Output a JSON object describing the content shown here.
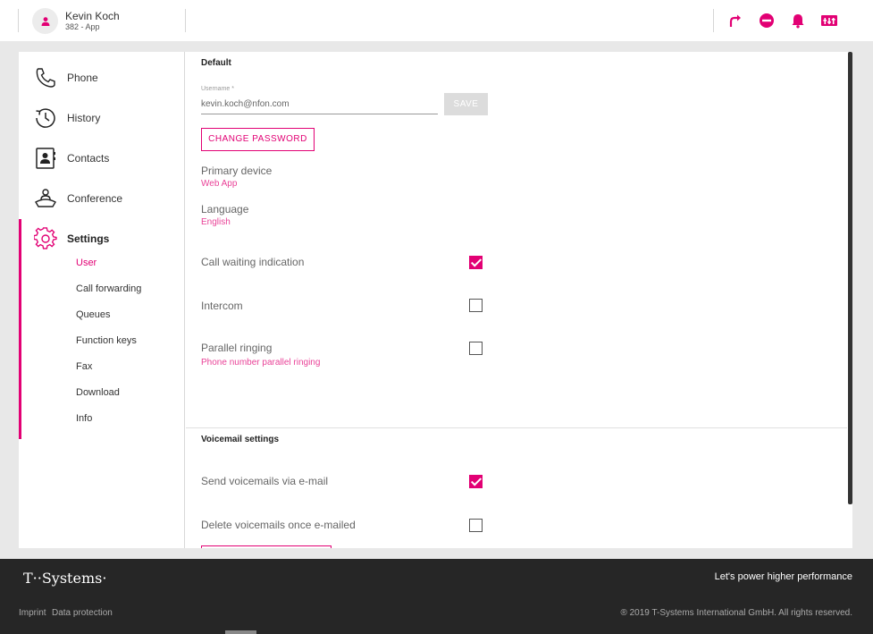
{
  "header": {
    "user_name": "Kevin Koch",
    "user_sub": "382 - App",
    "icons": [
      "redirect-icon",
      "do-not-disturb-icon",
      "bell-icon",
      "switchboard-icon"
    ]
  },
  "sidebar": {
    "items": [
      {
        "label": "Phone",
        "icon": "phone-icon"
      },
      {
        "label": "History",
        "icon": "history-icon"
      },
      {
        "label": "Contacts",
        "icon": "contacts-icon"
      },
      {
        "label": "Conference",
        "icon": "conference-icon"
      },
      {
        "label": "Settings",
        "icon": "gear-icon"
      }
    ],
    "sub_items": [
      "User",
      "Call forwarding",
      "Queues",
      "Function keys",
      "Fax",
      "Download",
      "Info"
    ],
    "active_sub": "User"
  },
  "main": {
    "section_default": "Default",
    "username_label": "Username *",
    "username_value": "kevin.koch@nfon.com",
    "save_label": "SAVE",
    "change_password_label": "CHANGE PASSWORD",
    "primary_device_label": "Primary device",
    "primary_device_value": "Web App",
    "language_label": "Language",
    "language_value": "English",
    "call_waiting_label": "Call waiting indication",
    "call_waiting_checked": true,
    "intercom_label": "Intercom",
    "intercom_checked": false,
    "parallel_label": "Parallel ringing",
    "parallel_sub": "Phone number parallel ringing",
    "parallel_checked": false,
    "section_voicemail": "Voicemail settings",
    "send_vm_label": "Send voicemails via e-mail",
    "send_vm_checked": true,
    "delete_vm_label": "Delete voicemails once e-mailed",
    "delete_vm_checked": false
  },
  "footer": {
    "brand": "T··Systems·",
    "tagline": "Let's power higher performance",
    "imprint": "Imprint",
    "data_protection": "Data protection",
    "copyright": "® 2019 T-Systems International GmbH. All rights reserved."
  },
  "colors": {
    "accent": "#e20074",
    "footer_bg": "#262626"
  }
}
